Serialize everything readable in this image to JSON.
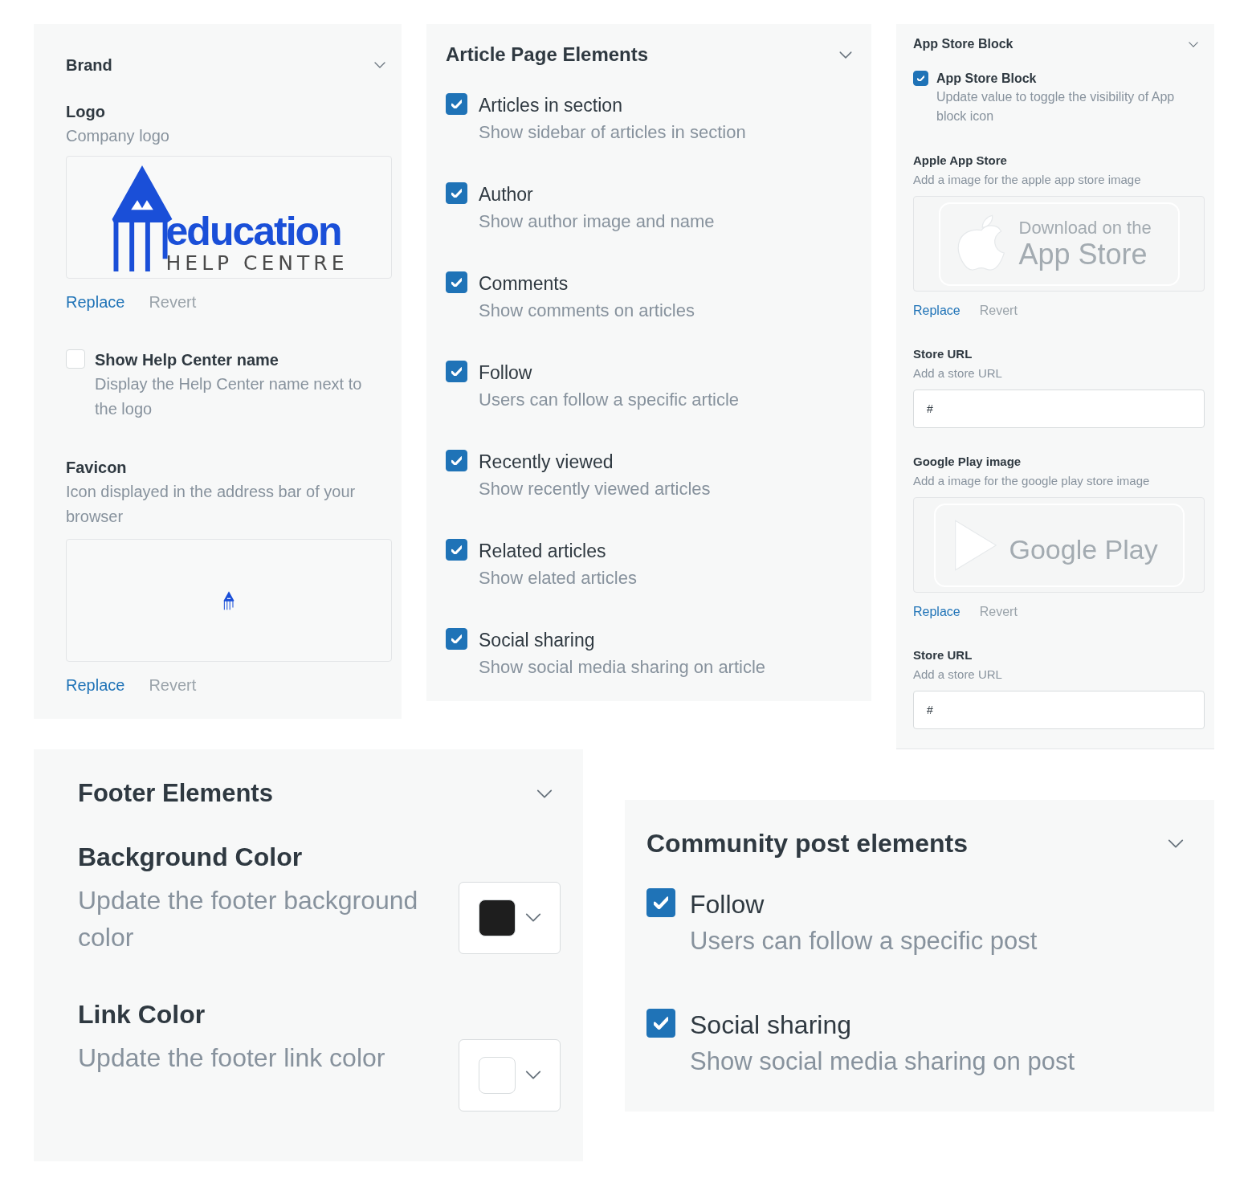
{
  "brand_panel": {
    "title": "Brand",
    "logo": {
      "label": "Logo",
      "description": "Company logo",
      "image": {
        "wordmark": "education",
        "tagline": "HELP CENTRE"
      },
      "actions": [
        {
          "label": "Replace",
          "disabled": false
        },
        {
          "label": "Revert",
          "disabled": true
        }
      ]
    },
    "show_name": {
      "label": "Show Help Center name",
      "description": "Display the Help Center name next to the logo",
      "checked": false
    },
    "favicon": {
      "label": "Favicon",
      "description": "Icon displayed in the address bar of your browser",
      "actions": [
        {
          "label": "Replace",
          "disabled": false
        },
        {
          "label": "Revert",
          "disabled": true
        }
      ]
    }
  },
  "article_panel": {
    "title": "Article Page Elements",
    "items": [
      {
        "label": "Articles in section",
        "description": "Show sidebar of articles in section",
        "checked": true
      },
      {
        "label": "Author",
        "description": "Show author image and name",
        "checked": true
      },
      {
        "label": "Comments",
        "description": "Show comments on articles",
        "checked": true
      },
      {
        "label": "Follow",
        "description": "Users can follow a specific article",
        "checked": true
      },
      {
        "label": "Recently viewed",
        "description": "Show recently viewed articles",
        "checked": true
      },
      {
        "label": "Related articles",
        "description": "Show elated articles",
        "checked": true
      },
      {
        "label": "Social sharing",
        "description": "Show social media sharing on article",
        "checked": true
      }
    ]
  },
  "app_store_panel": {
    "title": "App Store Block",
    "toggle": {
      "label": "App Store Block",
      "description": "Update value to toggle the visibility of App block icon",
      "checked": true
    },
    "sections": [
      {
        "kind": "image",
        "label": "Apple App Store",
        "description": "Add a image for the apple app store image",
        "badge": {
          "kind": "apple",
          "lines": [
            "Download on the",
            "App Store"
          ]
        },
        "actions": [
          {
            "label": "Replace",
            "disabled": false
          },
          {
            "label": "Revert",
            "disabled": true
          }
        ]
      },
      {
        "kind": "url",
        "label": "Store URL",
        "description": "Add a store URL",
        "value": "#"
      },
      {
        "kind": "image",
        "label": "Google Play image",
        "description": "Add a image for the google play store image",
        "badge": {
          "kind": "google",
          "lines": [
            "Google Play"
          ]
        },
        "actions": [
          {
            "label": "Replace",
            "disabled": false
          },
          {
            "label": "Revert",
            "disabled": true
          }
        ]
      },
      {
        "kind": "url",
        "label": "Store URL",
        "description": "Add a store URL",
        "value": "#"
      }
    ]
  },
  "footer_panel": {
    "title": "Footer Elements",
    "items": [
      {
        "label": "Background Color",
        "description": "Update the footer background color",
        "color": "#1e1e1e"
      },
      {
        "label": "Link Color",
        "description": "Update the footer link color",
        "color": "#ffffff"
      }
    ]
  },
  "community_panel": {
    "title": "Community post elements",
    "items": [
      {
        "label": "Follow",
        "description": "Users can follow a specific post",
        "checked": true
      },
      {
        "label": "Social sharing",
        "description": "Show social media sharing on post",
        "checked": true
      }
    ]
  }
}
